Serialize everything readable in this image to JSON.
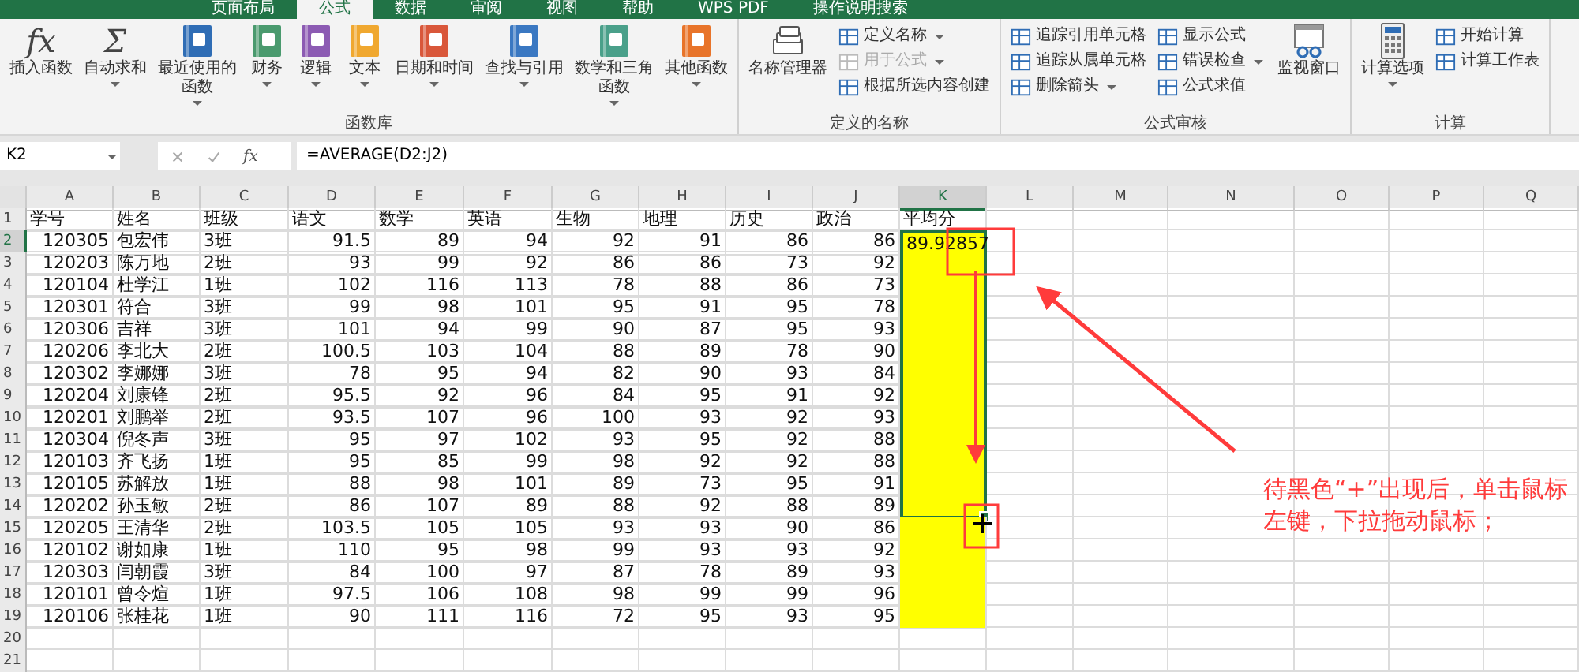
{
  "tabs": [
    {
      "label": "页面布局",
      "selected": false
    },
    {
      "label": "公式",
      "selected": true
    },
    {
      "label": "数据",
      "selected": false
    },
    {
      "label": "审阅",
      "selected": false
    },
    {
      "label": "视图",
      "selected": false
    },
    {
      "label": "帮助",
      "selected": false
    },
    {
      "label": "WPS PDF",
      "selected": false
    },
    {
      "label": "操作说明搜索",
      "selected": false
    }
  ],
  "ribbon": [
    {
      "label": "函数库",
      "items": [
        {
          "kind": "large",
          "label": "插入函数",
          "icon_text": "fx",
          "dropdown": false
        },
        {
          "kind": "large",
          "label": "自动求和",
          "icon_text": "Σ",
          "dropdown": true
        },
        {
          "kind": "large",
          "label": "最近使用的函数",
          "color": "#2f6db5",
          "dropdown": true
        },
        {
          "kind": "large",
          "label": "财务",
          "color": "#4a9a6e",
          "dropdown": true
        },
        {
          "kind": "large",
          "label": "逻辑",
          "color": "#8c5bb3",
          "dropdown": true
        },
        {
          "kind": "large",
          "label": "文本",
          "color": "#f0a830",
          "dropdown": true
        },
        {
          "kind": "large",
          "label": "日期和时间",
          "color": "#d9573a",
          "dropdown": true
        },
        {
          "kind": "large",
          "label": "查找与引用",
          "color": "#3a78c2",
          "dropdown": true
        },
        {
          "kind": "large",
          "label": "数学和三角函数",
          "color": "#4aa08a",
          "dropdown": true
        },
        {
          "kind": "large",
          "label": "其他函数",
          "color": "#e8742a",
          "dropdown": true
        }
      ]
    },
    {
      "label": "定义的名称",
      "items": [
        {
          "kind": "large",
          "label": "名称管理器",
          "dropdown": false
        },
        {
          "kind": "small",
          "label": "定义名称",
          "dropdown": true,
          "disabled": false
        },
        {
          "kind": "small",
          "label": "用于公式",
          "dropdown": true,
          "disabled": true
        },
        {
          "kind": "small",
          "label": "根据所选内容创建",
          "dropdown": false,
          "disabled": false
        }
      ]
    },
    {
      "label": "公式审核",
      "items": [
        {
          "kind": "small",
          "label": "追踪引用单元格",
          "dropdown": false,
          "disabled": false
        },
        {
          "kind": "small",
          "label": "追踪从属单元格",
          "dropdown": false,
          "disabled": false
        },
        {
          "kind": "small",
          "label": "删除箭头",
          "dropdown": true,
          "disabled": false
        },
        {
          "kind": "small",
          "label": "显示公式",
          "dropdown": false,
          "disabled": false
        },
        {
          "kind": "small",
          "label": "错误检查",
          "dropdown": true,
          "disabled": false
        },
        {
          "kind": "small",
          "label": "公式求值",
          "dropdown": false,
          "disabled": false
        },
        {
          "kind": "large",
          "label": "监视窗口",
          "dropdown": false
        }
      ]
    },
    {
      "label": "计算",
      "items": [
        {
          "kind": "large",
          "label": "计算选项",
          "dropdown": true
        },
        {
          "kind": "small",
          "label": "开始计算",
          "dropdown": false,
          "disabled": false
        },
        {
          "kind": "small",
          "label": "计算工作表",
          "dropdown": false,
          "disabled": false
        }
      ]
    }
  ],
  "formula_bar": {
    "name_box": "K2",
    "fx": "fx",
    "formula": "=AVERAGE(D2:J2)"
  },
  "sheet": {
    "columns": [
      {
        "label": "A",
        "kind": "number",
        "selected": false,
        "filled": false
      },
      {
        "label": "B",
        "kind": "text",
        "selected": false,
        "filled": false
      },
      {
        "label": "C",
        "kind": "text",
        "selected": false,
        "filled": false
      },
      {
        "label": "D",
        "kind": "number",
        "selected": false,
        "filled": false
      },
      {
        "label": "E",
        "kind": "number",
        "selected": false,
        "filled": false
      },
      {
        "label": "F",
        "kind": "number",
        "selected": false,
        "filled": false
      },
      {
        "label": "G",
        "kind": "number",
        "selected": false,
        "filled": false
      },
      {
        "label": "H",
        "kind": "number",
        "selected": false,
        "filled": false
      },
      {
        "label": "I",
        "kind": "number",
        "selected": false,
        "filled": false
      },
      {
        "label": "J",
        "kind": "number",
        "selected": false,
        "filled": false
      },
      {
        "label": "K",
        "kind": "number",
        "selected": true,
        "filled": true
      },
      {
        "label": "L",
        "kind": "text",
        "selected": false,
        "filled": false
      },
      {
        "label": "M",
        "kind": "text",
        "selected": false,
        "filled": false
      },
      {
        "label": "N",
        "kind": "text",
        "selected": false,
        "filled": false
      },
      {
        "label": "O",
        "kind": "text",
        "selected": false,
        "filled": false
      },
      {
        "label": "P",
        "kind": "text",
        "selected": false,
        "filled": false
      },
      {
        "label": "Q",
        "kind": "text",
        "selected": false,
        "filled": false
      }
    ],
    "rows": [
      {
        "num": "1",
        "kind": "header",
        "selected": false,
        "filled": false,
        "in_selection": false,
        "cells": [
          "学号",
          "姓名",
          "班级",
          "语文",
          "数学",
          "英语",
          "生物",
          "地理",
          "历史",
          "政治",
          "平均分"
        ]
      },
      {
        "num": "2",
        "kind": "data",
        "selected": true,
        "filled": true,
        "in_selection": true,
        "cells": [
          "120305",
          "包宏伟",
          "3班",
          "91.5",
          "89",
          "94",
          "92",
          "91",
          "86",
          "86",
          "89.92857"
        ]
      },
      {
        "num": "3",
        "kind": "data",
        "selected": false,
        "filled": true,
        "in_selection": true,
        "cells": [
          "120203",
          "陈万地",
          "2班",
          "93",
          "99",
          "92",
          "86",
          "86",
          "73",
          "92"
        ]
      },
      {
        "num": "4",
        "kind": "data",
        "selected": false,
        "filled": true,
        "in_selection": true,
        "cells": [
          "120104",
          "杜学江",
          "1班",
          "102",
          "116",
          "113",
          "78",
          "88",
          "86",
          "73"
        ]
      },
      {
        "num": "5",
        "kind": "data",
        "selected": false,
        "filled": true,
        "in_selection": true,
        "cells": [
          "120301",
          "符合",
          "3班",
          "99",
          "98",
          "101",
          "95",
          "91",
          "95",
          "78"
        ]
      },
      {
        "num": "6",
        "kind": "data",
        "selected": false,
        "filled": true,
        "in_selection": true,
        "cells": [
          "120306",
          "吉祥",
          "3班",
          "101",
          "94",
          "99",
          "90",
          "87",
          "95",
          "93"
        ]
      },
      {
        "num": "7",
        "kind": "data",
        "selected": false,
        "filled": true,
        "in_selection": true,
        "cells": [
          "120206",
          "李北大",
          "2班",
          "100.5",
          "103",
          "104",
          "88",
          "89",
          "78",
          "90"
        ]
      },
      {
        "num": "8",
        "kind": "data",
        "selected": false,
        "filled": true,
        "in_selection": true,
        "cells": [
          "120302",
          "李娜娜",
          "3班",
          "78",
          "95",
          "94",
          "82",
          "90",
          "93",
          "84"
        ]
      },
      {
        "num": "9",
        "kind": "data",
        "selected": false,
        "filled": true,
        "in_selection": true,
        "cells": [
          "120204",
          "刘康锋",
          "2班",
          "95.5",
          "92",
          "96",
          "84",
          "95",
          "91",
          "92"
        ]
      },
      {
        "num": "10",
        "kind": "data",
        "selected": false,
        "filled": true,
        "in_selection": true,
        "cells": [
          "120201",
          "刘鹏举",
          "2班",
          "93.5",
          "107",
          "96",
          "100",
          "93",
          "92",
          "93"
        ]
      },
      {
        "num": "11",
        "kind": "data",
        "selected": false,
        "filled": true,
        "in_selection": true,
        "cells": [
          "120304",
          "倪冬声",
          "3班",
          "95",
          "97",
          "102",
          "93",
          "95",
          "92",
          "88"
        ]
      },
      {
        "num": "12",
        "kind": "data",
        "selected": false,
        "filled": true,
        "in_selection": true,
        "cells": [
          "120103",
          "齐飞扬",
          "1班",
          "95",
          "85",
          "99",
          "98",
          "92",
          "92",
          "88"
        ]
      },
      {
        "num": "13",
        "kind": "data",
        "selected": false,
        "filled": true,
        "in_selection": true,
        "cells": [
          "120105",
          "苏解放",
          "1班",
          "88",
          "98",
          "101",
          "89",
          "73",
          "95",
          "91"
        ]
      },
      {
        "num": "14",
        "kind": "data",
        "selected": false,
        "filled": true,
        "in_selection": true,
        "cells": [
          "120202",
          "孙玉敏",
          "2班",
          "86",
          "107",
          "89",
          "88",
          "92",
          "88",
          "89"
        ]
      },
      {
        "num": "15",
        "kind": "data",
        "selected": false,
        "filled": true,
        "in_selection": false,
        "cells": [
          "120205",
          "王清华",
          "2班",
          "103.5",
          "105",
          "105",
          "93",
          "93",
          "90",
          "86"
        ]
      },
      {
        "num": "16",
        "kind": "data",
        "selected": false,
        "filled": true,
        "in_selection": false,
        "cells": [
          "120102",
          "谢如康",
          "1班",
          "110",
          "95",
          "98",
          "99",
          "93",
          "93",
          "92"
        ]
      },
      {
        "num": "17",
        "kind": "data",
        "selected": false,
        "filled": true,
        "in_selection": false,
        "cells": [
          "120303",
          "闫朝霞",
          "3班",
          "84",
          "100",
          "97",
          "87",
          "78",
          "89",
          "93"
        ]
      },
      {
        "num": "18",
        "kind": "data",
        "selected": false,
        "filled": true,
        "in_selection": false,
        "cells": [
          "120101",
          "曾令煊",
          "1班",
          "97.5",
          "106",
          "108",
          "98",
          "99",
          "99",
          "96"
        ]
      },
      {
        "num": "19",
        "kind": "data",
        "selected": false,
        "filled": true,
        "in_selection": false,
        "cells": [
          "120106",
          "张桂花",
          "1班",
          "90",
          "111",
          "116",
          "72",
          "95",
          "93",
          "95"
        ]
      },
      {
        "num": "20",
        "kind": "empty",
        "selected": false,
        "filled": false,
        "in_selection": false,
        "cells": []
      },
      {
        "num": "21",
        "kind": "empty",
        "selected": false,
        "filled": false,
        "in_selection": false,
        "cells": []
      }
    ]
  },
  "annotation": {
    "text": "待黑色“+”出现后，单击鼠标左键，下拉拖动鼠标；"
  }
}
